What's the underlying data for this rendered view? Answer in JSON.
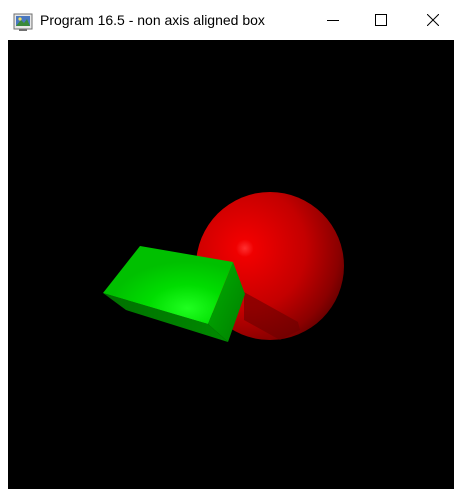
{
  "window": {
    "title": "Program 16.5 - non axis aligned box",
    "icon": "java-app-icon",
    "controls": [
      "minimize-icon",
      "maximize-icon",
      "close-icon"
    ]
  },
  "scene": {
    "background_color": "#000000",
    "objects": [
      {
        "name": "sphere",
        "color": "#cc0000"
      },
      {
        "name": "box",
        "color": "#00cc00"
      }
    ]
  }
}
